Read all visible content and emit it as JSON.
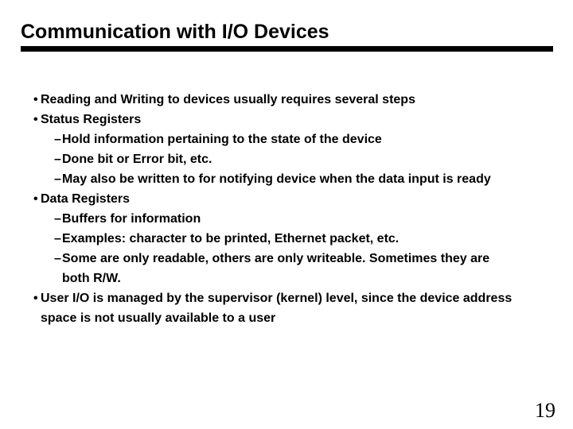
{
  "slide": {
    "title": "Communication with I/O Devices",
    "page_number": "19",
    "bullet_marker": "•",
    "dash_marker": "–",
    "content": [
      {
        "level": 1,
        "text": "Reading and Writing to devices usually requires several steps"
      },
      {
        "level": 1,
        "text": "Status Registers"
      },
      {
        "level": 2,
        "text": "Hold information pertaining to the state of the device"
      },
      {
        "level": 2,
        "text": "Done bit or Error bit, etc."
      },
      {
        "level": 2,
        "text": "May also be written to for notifying device when the data input is ready"
      },
      {
        "level": 1,
        "text": "Data Registers"
      },
      {
        "level": 2,
        "text": "Buffers for information"
      },
      {
        "level": 2,
        "text": "Examples: character to be printed, Ethernet packet, etc."
      },
      {
        "level": 2,
        "text": "Some are only readable, others are only writeable. Sometimes they are both R/W."
      },
      {
        "level": 1,
        "text": "User I/O is managed by the supervisor (kernel) level, since the device address space is not usually available to a user"
      }
    ]
  },
  "colors": {
    "background": "#ffffff",
    "text": "#000000",
    "rule": "#000000"
  }
}
